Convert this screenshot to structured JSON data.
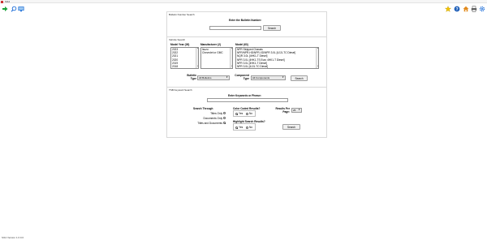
{
  "window": {
    "title": "SI12"
  },
  "colors": {
    "accent_blue": "#1f6fd8",
    "forward_green": "#1aa33a",
    "star_yellow": "#f3c400",
    "home_orange": "#e28b1e",
    "panel_border": "#d9d9d9"
  },
  "toolbar": {
    "left_icons": [
      "forward-arrow-icon",
      "search-icon",
      "monitor-icon"
    ],
    "right_icons": [
      "star-icon",
      "help-icon",
      "home-icon",
      "print-icon",
      "settings-icon"
    ]
  },
  "bulletin_search": {
    "section_title": "Bulletin Number Search",
    "prompt": "Enter the Bulletin Number:",
    "input_value": "",
    "button": "Search"
  },
  "vehicle_search": {
    "section_title": "Vehicle Search",
    "model_year_label": "Model Year (26)",
    "manufacturer_label": "Manufacturer (2)",
    "model_label": "Model (63)",
    "model_years": [
      "2023",
      "2022",
      "2021",
      "2020",
      "2019",
      "2018"
    ],
    "manufacturers": [
      "Isuzu",
      "Chevrolet or GMC"
    ],
    "models": [
      "NPR Stripped Chassis",
      "NPR/NPR-HD/NPR-XD/NPR 3.0L [4JJ1-TC Diesel]",
      "NQR 3.0L [4HK1-T Diesel]",
      "NPR 3.0L [4HK1-TS Euro 4HK1-T Diesel]",
      "NPR 3.0L [4HK1-T Diesel]",
      "NPR 3.0L [4JJ1-TC Diesel]"
    ],
    "bulletin_type_label": "Bulletin Type",
    "bulletin_type_value": "All Bulletins",
    "component_type_label": "Component Type",
    "component_type_value": "All Components",
    "button": "Search"
  },
  "keyword_search": {
    "section_title": "TSB Keyword Search",
    "prompt": "Enter Keywords or Phrase:",
    "input_value": "",
    "search_through_label": "Search Through",
    "search_options": [
      "Titles Only",
      "Documents Only",
      "Titles and Documents"
    ],
    "search_selected": 2,
    "color_coded_label": "Color Coded Results?",
    "color_coded_options": [
      "Yes",
      "No"
    ],
    "color_coded_selected": 0,
    "results_per_page_label": "Results Per Page:",
    "results_per_page_value": "25",
    "highlight_label": "Highlight Search Results?",
    "highlight_options": [
      "Yes",
      "No"
    ],
    "highlight_selected": 0,
    "button": "Search"
  },
  "status": {
    "text": "SI12 Version 1.0.0.0"
  }
}
